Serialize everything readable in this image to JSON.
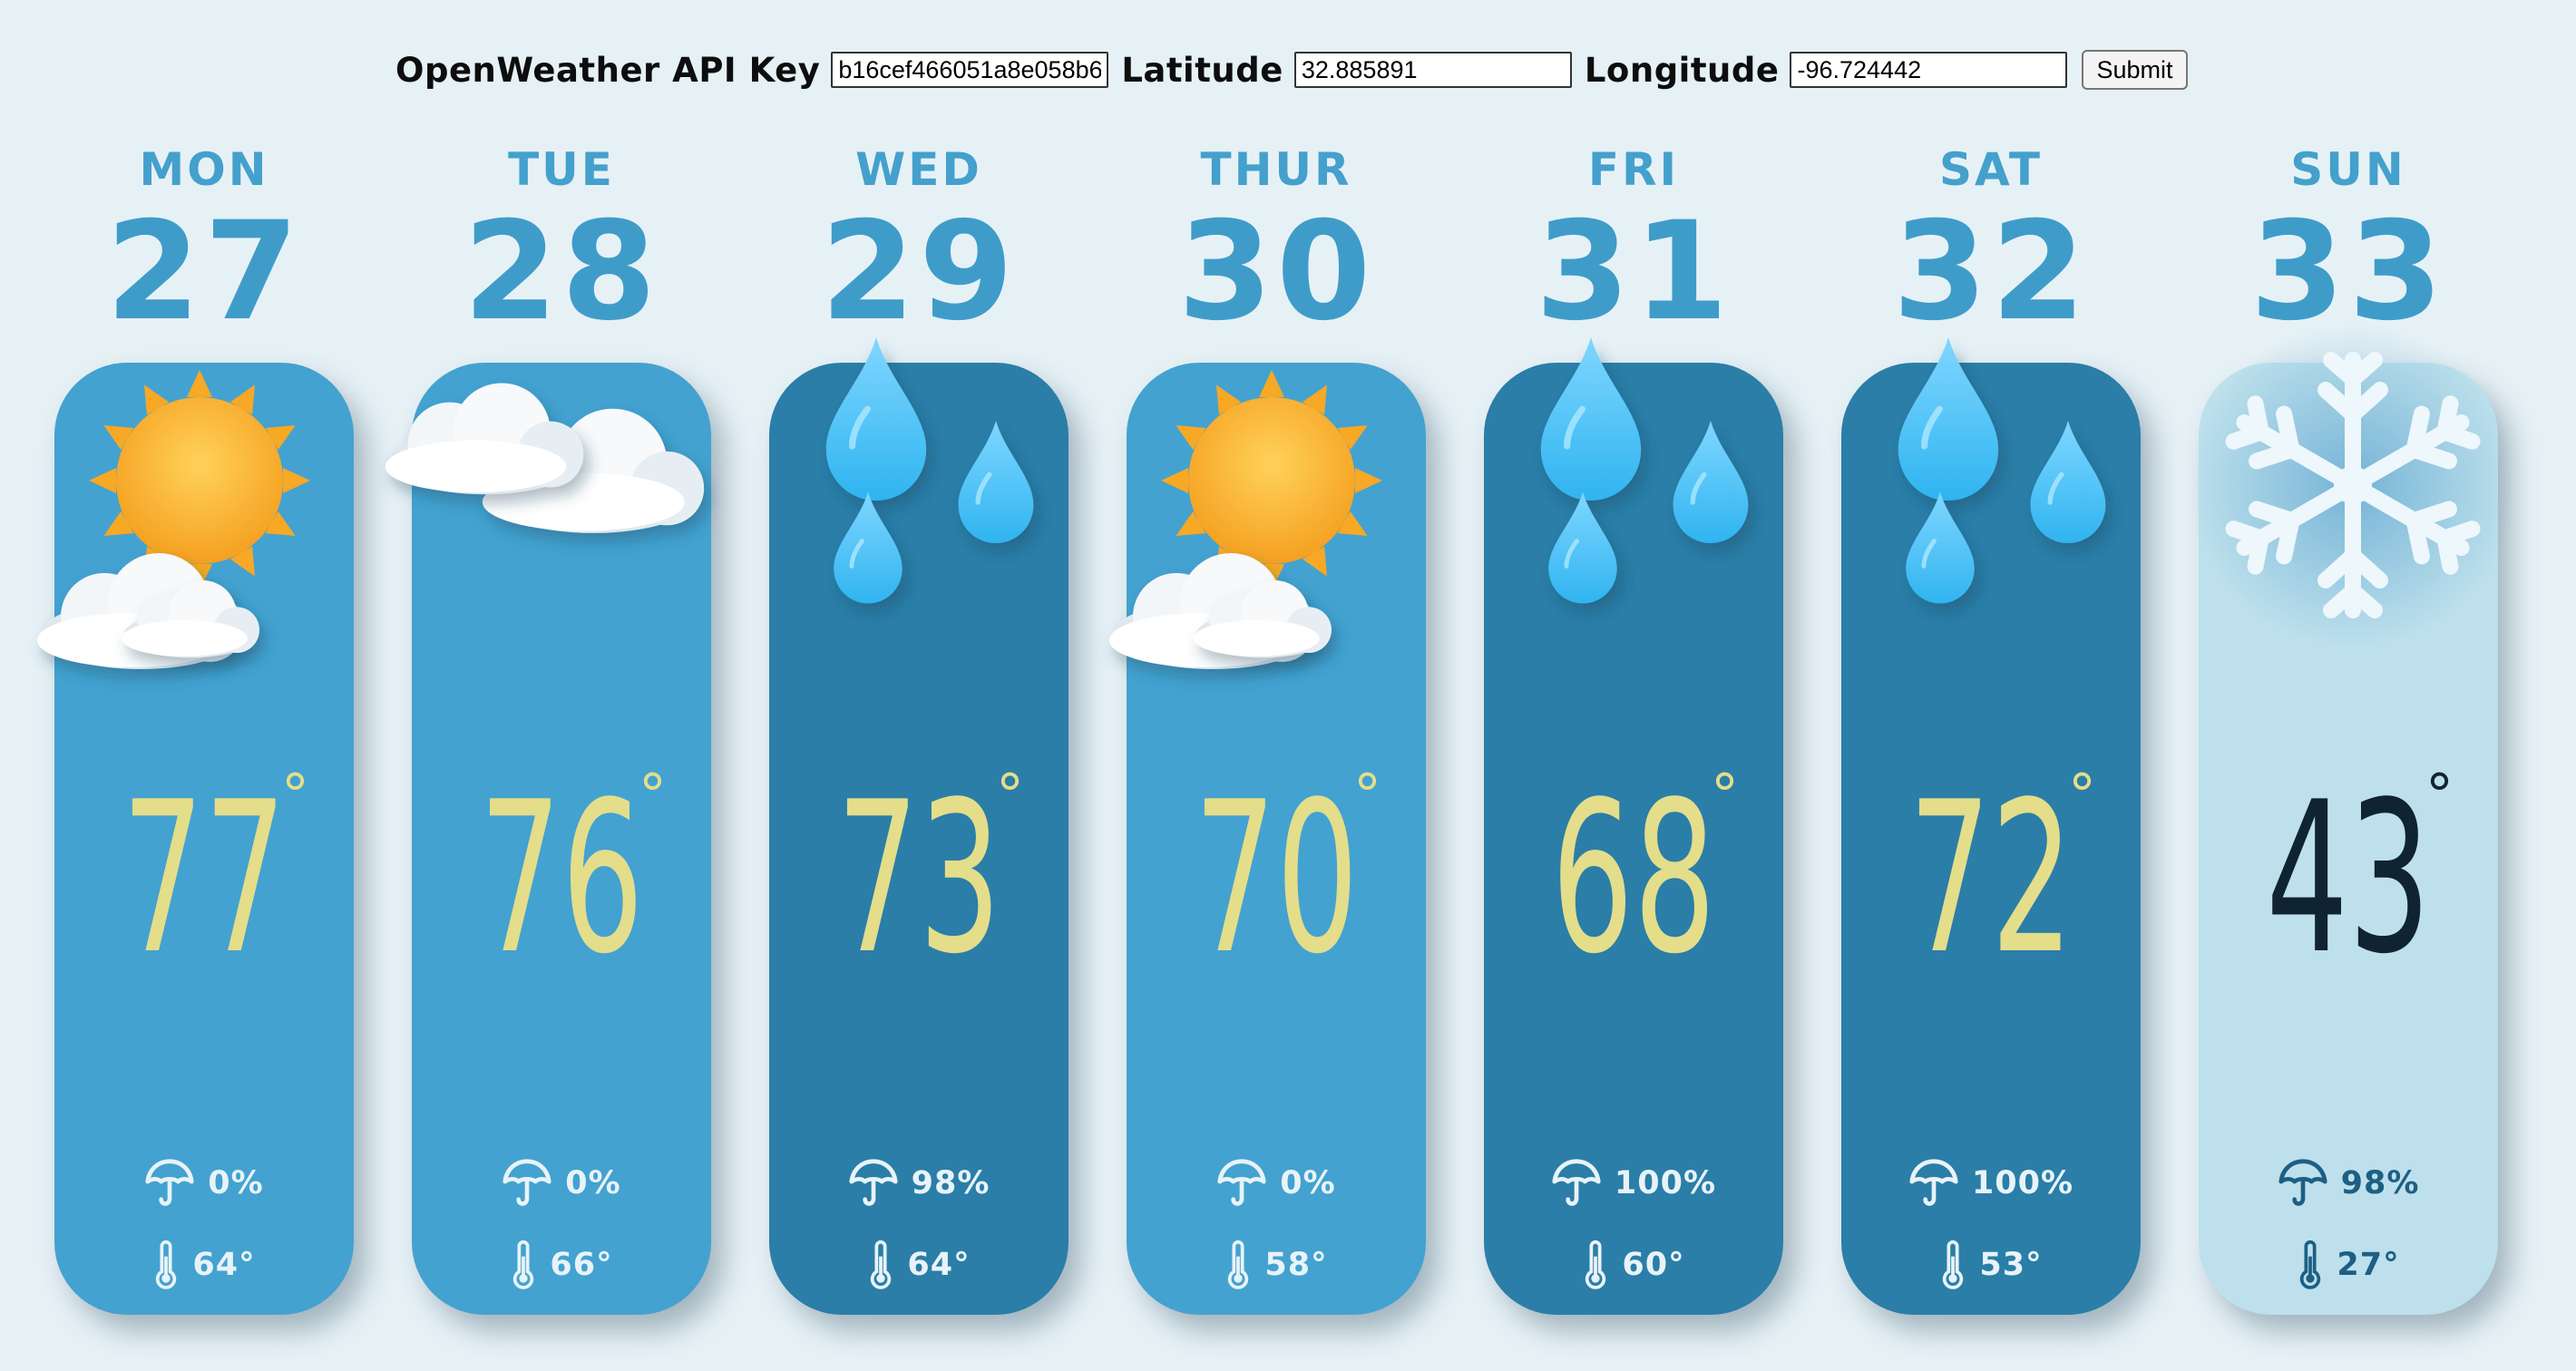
{
  "form": {
    "api_key_label": "OpenWeather API Key",
    "api_key_value": "b16cef466051a8e058b6",
    "latitude_label": "Latitude",
    "latitude_value": "32.885891",
    "longitude_label": "Longitude",
    "longitude_value": "-96.724442",
    "submit_label": "Submit"
  },
  "days": [
    {
      "name": "MON",
      "num": "27",
      "temp": "77",
      "rain": "0%",
      "low": "64°",
      "icon": "partly-cloudy-icon",
      "style": "light"
    },
    {
      "name": "TUE",
      "num": "28",
      "temp": "76",
      "rain": "0%",
      "low": "66°",
      "icon": "cloudy-icon",
      "style": "light"
    },
    {
      "name": "WED",
      "num": "29",
      "temp": "73",
      "rain": "98%",
      "low": "64°",
      "icon": "rain-icon",
      "style": "dark"
    },
    {
      "name": "THUR",
      "num": "30",
      "temp": "70",
      "rain": "0%",
      "low": "58°",
      "icon": "partly-cloudy-icon",
      "style": "light"
    },
    {
      "name": "FRI",
      "num": "31",
      "temp": "68",
      "rain": "100%",
      "low": "60°",
      "icon": "rain-icon",
      "style": "dark"
    },
    {
      "name": "SAT",
      "num": "32",
      "temp": "72",
      "rain": "100%",
      "low": "53°",
      "icon": "rain-icon",
      "style": "dark"
    },
    {
      "name": "SUN",
      "num": "33",
      "temp": "43",
      "rain": "98%",
      "low": "27°",
      "icon": "snow-icon",
      "style": "snow"
    }
  ],
  "degree_symbol": "°",
  "colors": {
    "background": "#e6f1f6",
    "card_light": "#43a2d0",
    "card_dark": "#2a7ea8",
    "card_snow": "#bde0ec",
    "temperature": "#e4dd8a",
    "heading": "#3f9cc9"
  }
}
